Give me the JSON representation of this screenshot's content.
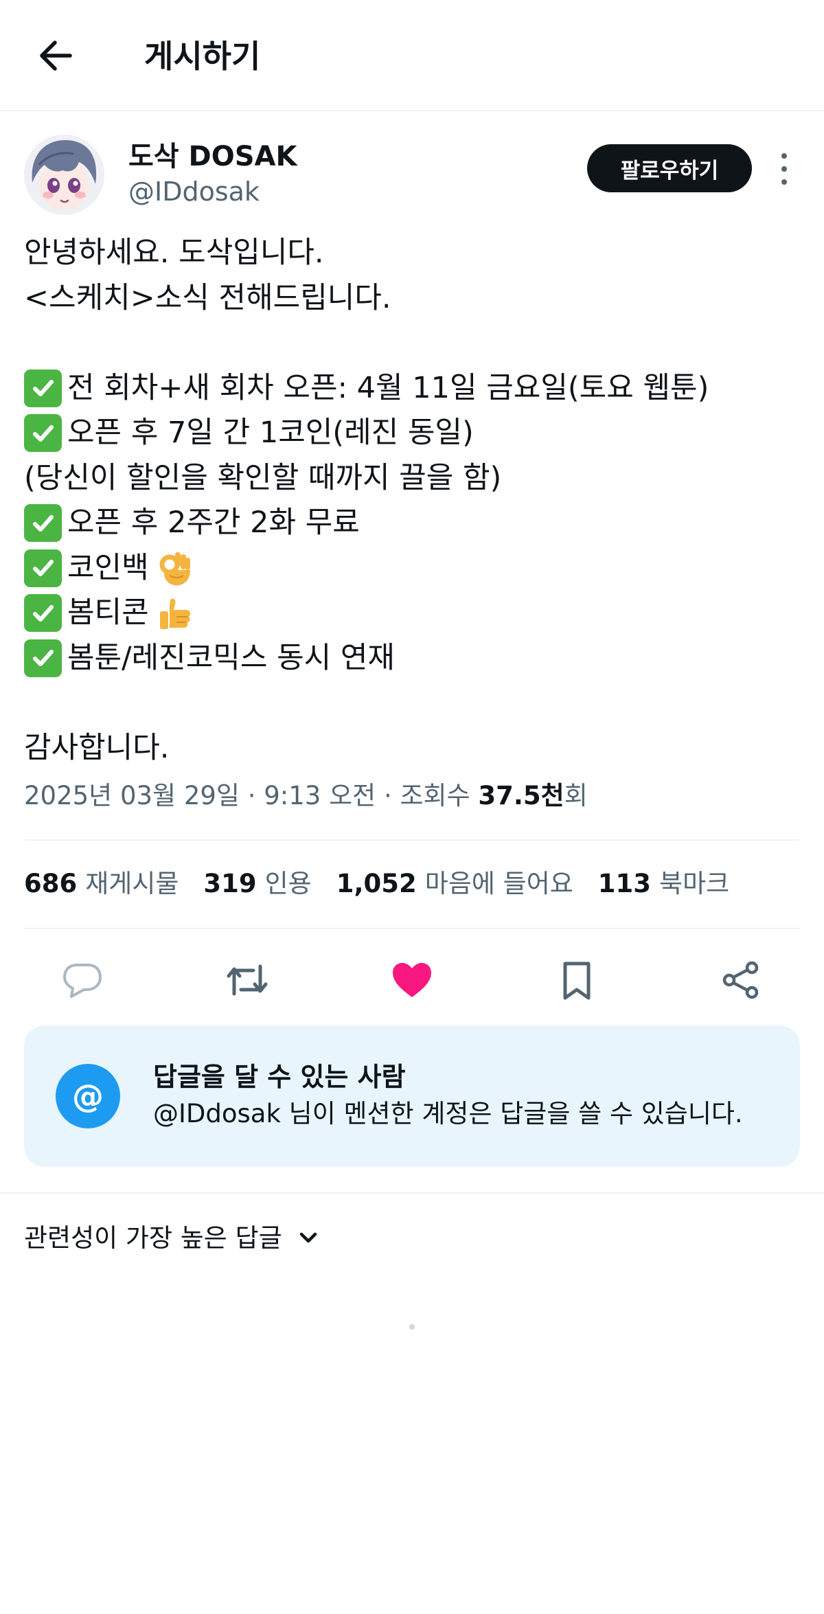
{
  "header": {
    "title": "게시하기",
    "back_icon": "arrow-left-icon"
  },
  "author": {
    "display_name": "도삭 DOSAK",
    "handle": "@IDdosak",
    "follow_label": "팔로우하기"
  },
  "tweet": {
    "greeting": "안녕하세요. 도삭입니다.",
    "intro": "<스케치>소식 전해드립니다.",
    "item1": "전 회차+새 회차 오픈: 4월 11일 금요일(토요 웹툰)",
    "item2": "오픈 후 7일 간 1코인(레진 동일)",
    "item2_note": "(당신이 할인을 확인할 때까지 끌을 함)",
    "item3": "오픈 후 2주간 2화 무료",
    "item4": "코인백",
    "item5": "봄티콘",
    "item6": "봄툰/레진코믹스 동시 연재",
    "closing": "감사합니다."
  },
  "meta": {
    "datetime": "2025년 03월 29일 · 9:13 오전 · 조회수 ",
    "views": "37.5천",
    "views_unit": "회"
  },
  "stats": {
    "retweets_count": "686",
    "retweets_label": "재게시물",
    "quotes_count": "319",
    "quotes_label": "인용",
    "likes_count": "1,052",
    "likes_label": "마음에 들어요",
    "bookmarks_count": "113",
    "bookmarks_label": "북마크"
  },
  "reply_notice": {
    "title": "답글을 달 수 있는 사람",
    "description": "@IDdosak 님이 멘션한 계정은 답글을 쓸 수 있습니다.",
    "icon_text": "@"
  },
  "replies": {
    "sort_label": "관련성이 가장 높은 답글"
  },
  "colors": {
    "like_active": "#f91880",
    "accent": "#1d9bf0",
    "checkmark": "#4bb543",
    "card_bg": "#e8f5fd"
  }
}
